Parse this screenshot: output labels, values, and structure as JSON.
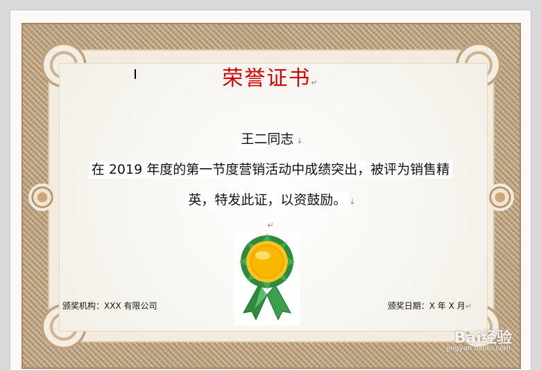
{
  "certificate": {
    "title": "荣誉证书",
    "recipient": "王二同志",
    "body_line1": "在 2019 年度的第一节度营销活动中成绩突出，被评为销售精",
    "body_line2": "英，特发此证，以资鼓励。",
    "issuer": "颁奖机构：XXX 有限公司",
    "date": "颁奖日期：X 年 X 月"
  },
  "marks": {
    "paragraph": "↵",
    "line_break": "↓"
  },
  "watermark": {
    "brand": "Bai经验",
    "sub": "jingyan.baidu.com"
  },
  "colors": {
    "title": "#d40000",
    "frame": "#b89c78",
    "medal_gold": "#f2a900",
    "medal_green": "#2e8b3e"
  }
}
